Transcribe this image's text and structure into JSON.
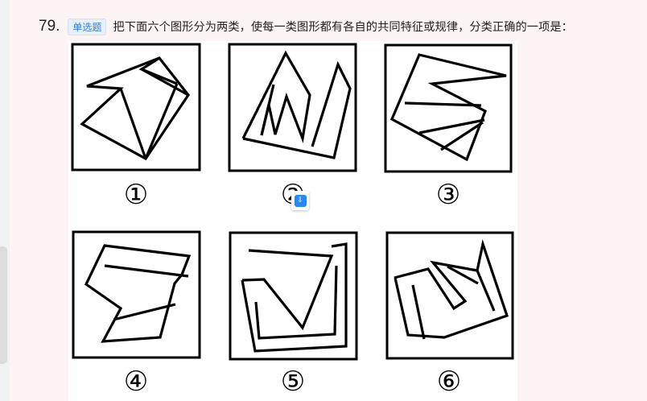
{
  "question": {
    "number": "79.",
    "type_badge": "单选题",
    "text": "把下面六个图形分为两类，使每一类图形都有各自的共同特征或规律，分类正确的一项是："
  },
  "figures": [
    {
      "label": "①"
    },
    {
      "label": "②"
    },
    {
      "label": "③"
    },
    {
      "label": "④"
    },
    {
      "label": "⑤"
    },
    {
      "label": "⑥"
    }
  ],
  "icons": {
    "floating_tool": "download-app-icon"
  },
  "colors": {
    "page_background": "#fdf5f5",
    "badge_text": "#3a7bd5",
    "badge_background": "#e8f0fc",
    "icon_blue": "#2b88e8"
  }
}
